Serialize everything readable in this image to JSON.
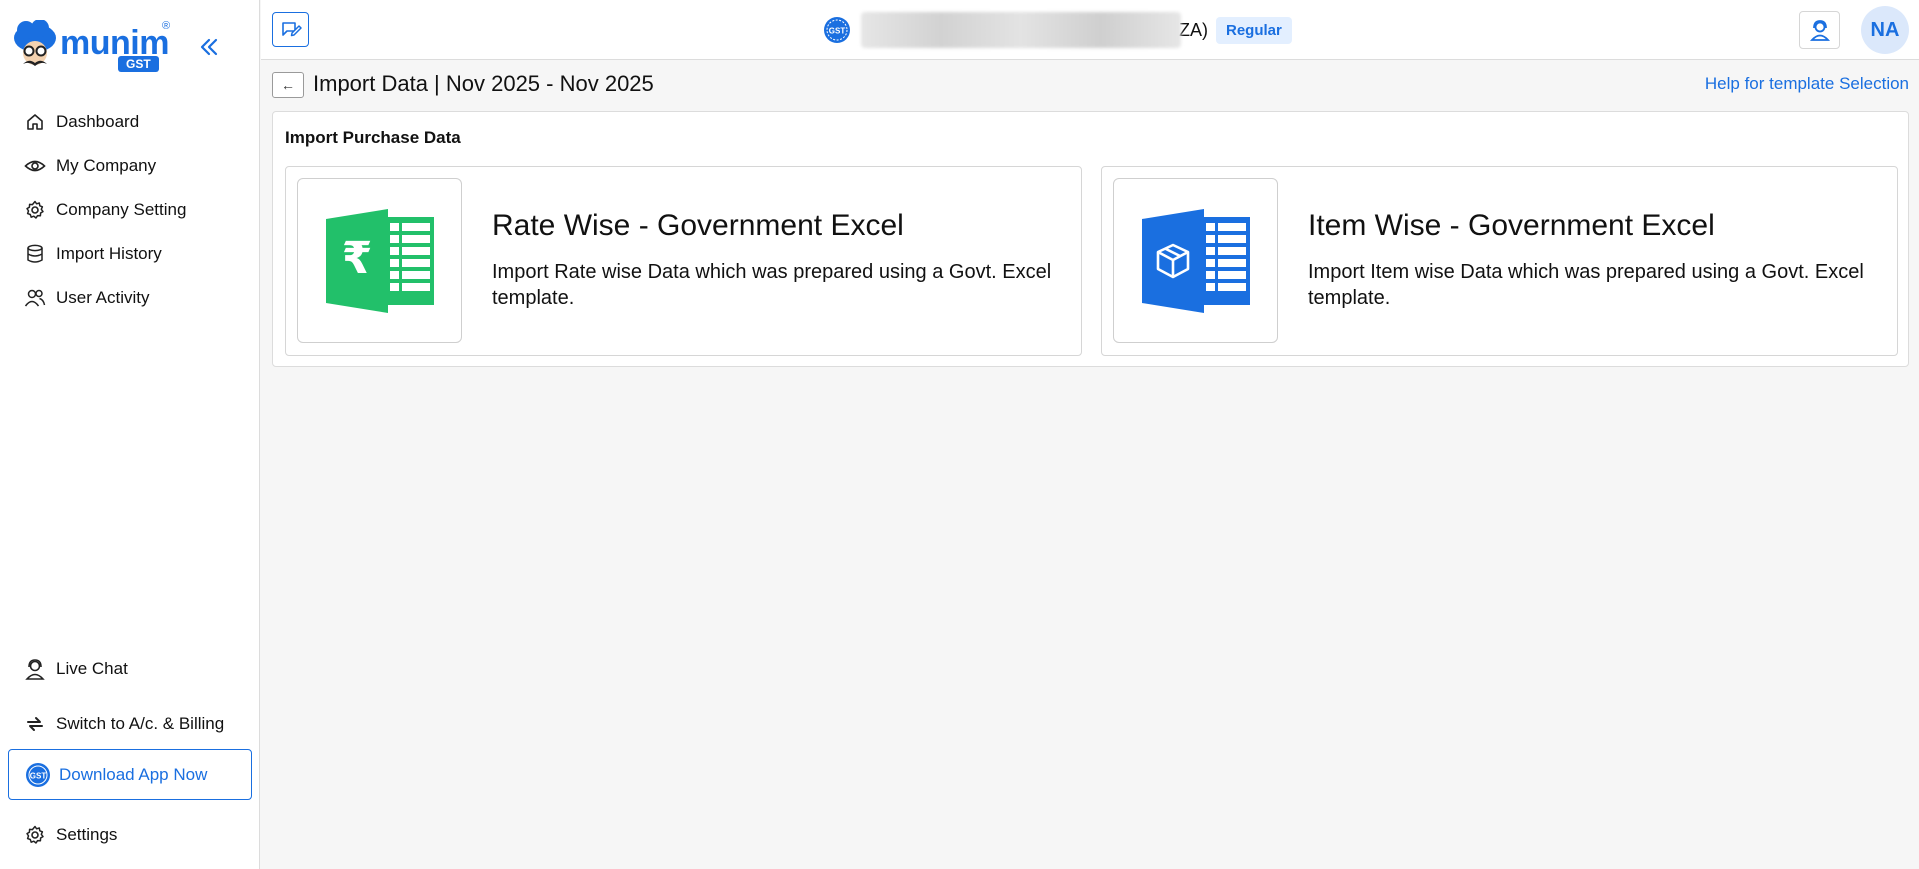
{
  "brand": {
    "name": "munim",
    "badge": "GST",
    "registered": "®"
  },
  "sidebar": {
    "collapse_icon": "double-chevron-left-icon",
    "items": [
      {
        "label": "Dashboard",
        "icon": "home-icon"
      },
      {
        "label": "My Company",
        "icon": "eye-icon"
      },
      {
        "label": "Company Setting",
        "icon": "gear-icon"
      },
      {
        "label": "Import History",
        "icon": "database-icon"
      },
      {
        "label": "User Activity",
        "icon": "users-icon"
      }
    ],
    "bottom": {
      "live_chat": "Live Chat",
      "switch": "Switch to A/c. & Billing",
      "download": "Download App Now",
      "settings": "Settings"
    }
  },
  "header": {
    "company_suffix": "ZA)",
    "company_type": "Regular",
    "avatar_initials": "NA"
  },
  "page": {
    "back_icon": "←",
    "title": "Import Data | Nov 2025 - Nov 2025",
    "help_link": "Help for template Selection"
  },
  "section": {
    "title": "Import Purchase Data",
    "cards": [
      {
        "title": "Rate Wise - Government Excel",
        "desc": "Import Rate wise Data which was prepared using a Govt. Excel template.",
        "icon": "rupee-excel-icon",
        "color": "#22c06a"
      },
      {
        "title": "Item Wise - Government Excel",
        "desc": "Import Item wise Data which was prepared using a Govt. Excel template.",
        "icon": "box-excel-icon",
        "color": "#1a6fe0"
      }
    ]
  },
  "colors": {
    "accent": "#1a6fe0",
    "excel_green": "#22c06a"
  }
}
